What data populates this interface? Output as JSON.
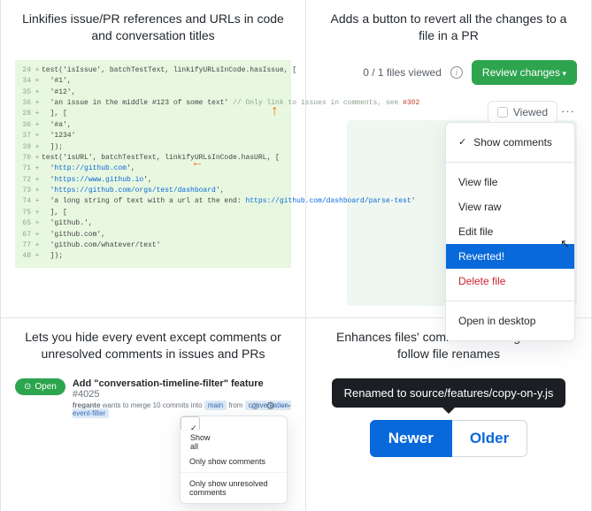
{
  "features": {
    "linkify": {
      "title": "Linkifies issue/PR references and URLs in code and conversation titles",
      "lines": [
        {
          "n": "24",
          "txt": "test('isIssue', batchTestText, linkifyURLsInCode.hasIssue, ["
        },
        {
          "n": "34",
          "txt": "  '#1',"
        },
        {
          "n": "35",
          "txt": "  '#12',"
        },
        {
          "n": "36",
          "txt": "  'an issue in the middle #123 of some text' // Only link to issues in comments, see #302",
          "pale": true,
          "ref": "#302"
        },
        {
          "n": "28",
          "txt": "  ], ["
        },
        {
          "n": "36",
          "txt": "  '#a',"
        },
        {
          "n": "37",
          "txt": "  '1234'"
        },
        {
          "n": "39",
          "txt": "  ]);"
        },
        {
          "n": "",
          "txt": ""
        },
        {
          "n": "70",
          "txt": "test('isURL', batchTestText, linkifyURLsInCode.hasURL, ["
        },
        {
          "n": "71",
          "txt": "  'http://github.com',",
          "link": true
        },
        {
          "n": "72",
          "txt": "  'https://www.github.io',",
          "link": true
        },
        {
          "n": "73",
          "txt": "  'https://github.com/orgs/test/dashboard',",
          "link": true
        },
        {
          "n": "74",
          "txt": "  'a long string of text with a url at the end: https://github.com/dashboard/parse-test'",
          "link": true
        },
        {
          "n": "75",
          "txt": "  ], ["
        },
        {
          "n": "65",
          "txt": "  'github.',"
        },
        {
          "n": "67",
          "txt": "  'github.com',"
        },
        {
          "n": "77",
          "txt": "  'github.com/whatever/text'"
        },
        {
          "n": "48",
          "txt": "  ]);"
        }
      ]
    },
    "revert": {
      "title": "Adds a button to revert all the changes to a file in a PR",
      "files_viewed": "0 / 1 files viewed",
      "review_btn": "Review changes",
      "viewed_label": "Viewed",
      "menu": {
        "show_comments": "Show comments",
        "view_file": "View file",
        "view_raw": "View raw",
        "edit_file": "Edit file",
        "reverted": "Reverted!",
        "delete_file": "Delete file",
        "open_desktop": "Open in desktop"
      }
    },
    "timeline_filter": {
      "title": "Lets you hide every event except comments or unresolved comments in issues and PRs",
      "open_label": "Open",
      "issue_title": "Add \"conversation-timeline-filter\" feature",
      "issue_num": "#4025",
      "sub_user": "fregante",
      "sub_action": "wants to merge 10 commits into",
      "sub_target": "main",
      "sub_from": "from",
      "sub_branch": "conversation-event-filter",
      "menu": {
        "show_all": "Show all",
        "only_comments": "Only show comments",
        "only_unresolved": "Only show unresolved comments"
      }
    },
    "rename_nav": {
      "title": "Enhances files' commit lists navigation to follow file renames",
      "tooltip": "Renamed to source/features/copy-on-y.js",
      "newer": "Newer",
      "older": "Older"
    }
  }
}
